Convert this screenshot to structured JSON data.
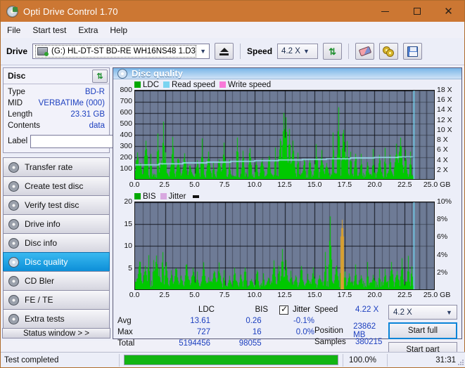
{
  "window": {
    "title": "Opti Drive Control 1.70",
    "icon": "disc-icon",
    "minimize": "—",
    "maximize": "☐",
    "close": "✕"
  },
  "menu": {
    "items": [
      "File",
      "Start test",
      "Extra",
      "Help"
    ]
  },
  "toolbar": {
    "drive_label": "Drive",
    "drive_value": "(G:)   HL-DT-ST BD-RE  WH16NS48 1.D3",
    "eject_icon": "eject-icon",
    "speed_label": "Speed",
    "speed_value": "4.2 X",
    "refresh_icon": "refresh-icon",
    "erase_icon": "eraser-icon",
    "discs_icon": "discs-icon",
    "save_icon": "save-icon"
  },
  "disc": {
    "group_title": "Disc",
    "refresh_icon": "refresh-icon",
    "rows": [
      {
        "key": "Type",
        "value": "BD-R"
      },
      {
        "key": "MID",
        "value": "VERBATIMe (000)"
      },
      {
        "key": "Length",
        "value": "23.31 GB"
      },
      {
        "key": "Contents",
        "value": "data"
      }
    ],
    "label_key": "Label",
    "label_value": "",
    "label_placeholder": "",
    "label_button_icon": "disc-icon"
  },
  "sidebar": {
    "items": [
      {
        "label": "Transfer rate",
        "active": false
      },
      {
        "label": "Create test disc",
        "active": false
      },
      {
        "label": "Verify test disc",
        "active": false
      },
      {
        "label": "Drive info",
        "active": false
      },
      {
        "label": "Disc info",
        "active": false
      },
      {
        "label": "Disc quality",
        "active": true
      },
      {
        "label": "CD Bler",
        "active": false
      },
      {
        "label": "FE / TE",
        "active": false
      },
      {
        "label": "Extra tests",
        "active": false
      }
    ],
    "status_window_button": "Status window > >"
  },
  "panel": {
    "header_title": "Disc quality",
    "header_icon": "disc-quality-icon"
  },
  "chart_data": [
    {
      "id": "top",
      "type": "line",
      "title": "",
      "xlabel": "GB",
      "ylabel": "",
      "xlim": [
        0,
        25
      ],
      "xticks": [
        "0.0",
        "2.5",
        "5.0",
        "7.5",
        "10.0",
        "12.5",
        "15.0",
        "17.5",
        "20.0",
        "22.5",
        "25.0 GB"
      ],
      "ylim": [
        0,
        800
      ],
      "yticks": [
        100,
        200,
        300,
        400,
        500,
        600,
        700,
        800
      ],
      "y2lim": [
        0,
        18
      ],
      "y2ticks": [
        "2 X",
        "4 X",
        "6 X",
        "8 X",
        "10 X",
        "12 X",
        "14 X",
        "16 X",
        "18 X"
      ],
      "grid": true,
      "legend_position": "top-left",
      "legend": [
        {
          "name": "LDC",
          "color": "#00a800"
        },
        {
          "name": "Read speed",
          "color": "#7ad4f0"
        },
        {
          "name": "Write speed",
          "color": "#f878d8"
        }
      ],
      "series": [
        {
          "name": "LDC",
          "color": "#00c800",
          "type": "impulse",
          "x_end_gb": 23.31,
          "baseline": 40,
          "peaks_gb": [
            0.15,
            0.4,
            0.9,
            1.3,
            1.9,
            2.2,
            2.35,
            2.5,
            3.0,
            3.1,
            3.6,
            4.1,
            4.6,
            5.2,
            5.6,
            6.1,
            6.5,
            7.0,
            7.4,
            7.9,
            8.5,
            9.0,
            9.6,
            10.1,
            10.6,
            11.2,
            11.7,
            12.1,
            12.4,
            12.6,
            12.9,
            13.2,
            13.6,
            14.1,
            14.6,
            15.1,
            15.6,
            16.0,
            16.5,
            17.0,
            17.4,
            17.7,
            18.0,
            18.4,
            18.9,
            19.4,
            19.9,
            20.4,
            20.9,
            21.3,
            21.8,
            22.2,
            22.6,
            23.0
          ],
          "peaks_y": [
            300,
            180,
            420,
            260,
            430,
            200,
            540,
            310,
            170,
            390,
            230,
            260,
            150,
            190,
            360,
            240,
            170,
            210,
            320,
            180,
            420,
            260,
            330,
            190,
            230,
            260,
            310,
            480,
            720,
            620,
            440,
            360,
            280,
            230,
            200,
            310,
            260,
            180,
            440,
            620,
            530,
            380,
            300,
            250,
            220,
            190,
            260,
            230,
            300,
            210,
            330,
            450,
            260,
            290
          ]
        },
        {
          "name": "Read speed",
          "color": "#9fe0f4",
          "type": "step",
          "x_gb": [
            0,
            2.0,
            4.0,
            6.0,
            8.0,
            10.0,
            12.0,
            14.0,
            16.0,
            18.0,
            20.0,
            22.0,
            23.2
          ],
          "speed_x": [
            2.9,
            3.1,
            3.3,
            3.45,
            3.6,
            3.75,
            3.9,
            4.0,
            4.15,
            4.3,
            4.4,
            4.5,
            4.55
          ]
        },
        {
          "name": "Write speed",
          "color": "#f878d8",
          "type": "none",
          "values": []
        }
      ],
      "end_marker_gb": 23.31,
      "end_marker_color": "#6fd8f5"
    },
    {
      "id": "bottom",
      "type": "line",
      "title": "",
      "xlabel": "GB",
      "xlim": [
        0,
        25
      ],
      "xticks": [
        "0.0",
        "2.5",
        "5.0",
        "7.5",
        "10.0",
        "12.5",
        "15.0",
        "17.5",
        "20.0",
        "22.5",
        "25.0 GB"
      ],
      "ylim": [
        0,
        20
      ],
      "yticks": [
        5,
        10,
        15,
        20
      ],
      "y2lim": [
        0,
        10
      ],
      "y2ticks": [
        "2%",
        "4%",
        "6%",
        "8%",
        "10%"
      ],
      "grid": true,
      "legend_position": "top-left",
      "legend": [
        {
          "name": "BIS",
          "color": "#00a800"
        },
        {
          "name": "Jitter",
          "color": "#d8a8e0"
        }
      ],
      "series": [
        {
          "name": "BIS",
          "color": "#00c800",
          "type": "impulse",
          "x_end_gb": 23.31,
          "baseline": 1.4,
          "peaks_gb": [
            0.1,
            0.35,
            0.8,
            1.1,
            1.5,
            1.75,
            2.0,
            2.3,
            2.6,
            3.0,
            3.4,
            3.8,
            4.3,
            4.8,
            5.2,
            5.7,
            6.1,
            6.6,
            7.0,
            7.4,
            7.9,
            8.3,
            8.8,
            9.2,
            9.7,
            10.2,
            10.7,
            11.1,
            11.6,
            12.0,
            12.3,
            12.6,
            13.0,
            13.4,
            13.9,
            14.4,
            14.9,
            15.4,
            15.9,
            16.3,
            16.8,
            17.2,
            17.5,
            17.9,
            18.4,
            18.9,
            19.4,
            19.9,
            20.4,
            20.9,
            21.4,
            21.9,
            22.3,
            22.8,
            23.1
          ],
          "peaks_y": [
            3,
            8,
            6.5,
            9,
            7,
            9.2,
            5,
            11,
            8,
            4.5,
            6,
            3.5,
            7,
            5.5,
            4,
            6,
            3,
            5,
            6,
            4.5,
            3.5,
            5,
            4,
            6,
            3,
            5.5,
            4,
            3.5,
            8,
            6,
            9,
            7,
            5,
            4,
            6,
            3.5,
            5,
            4,
            9,
            16,
            6.5,
            7,
            5,
            4,
            5.5,
            4,
            6,
            3.5,
            5,
            4.5,
            6.5,
            5,
            7,
            9,
            6
          ]
        },
        {
          "name": "Jitter",
          "color": "#d8a030",
          "type": "impulse-overlay",
          "peaks_gb": [
            17.3
          ],
          "peaks_y": [
            16
          ]
        }
      ],
      "end_marker_gb": 23.31,
      "end_marker_color": "#6fd8f5"
    }
  ],
  "stats": {
    "col_headers": [
      "LDC",
      "BIS"
    ],
    "jitter_label": "Jitter",
    "jitter_checked": true,
    "rows": [
      {
        "label": "Avg",
        "ldc": "13.61",
        "bis": "0.26",
        "jitter": "-0.1%"
      },
      {
        "label": "Max",
        "ldc": "727",
        "bis": "16",
        "jitter": "0.0%"
      },
      {
        "label": "Total",
        "ldc": "5194456",
        "bis": "98055",
        "jitter": ""
      }
    ]
  },
  "controls": {
    "speed_label": "Speed",
    "speed_value": "4.22 X",
    "position_label": "Position",
    "position_value": "23862 MB",
    "samples_label": "Samples",
    "samples_value": "380215",
    "speed_select": "4.2 X",
    "start_full": "Start full",
    "start_part": "Start part"
  },
  "statusbar": {
    "message": "Test completed",
    "progress_percent": "100.0%",
    "progress_value": 100,
    "elapsed": "31:31"
  }
}
